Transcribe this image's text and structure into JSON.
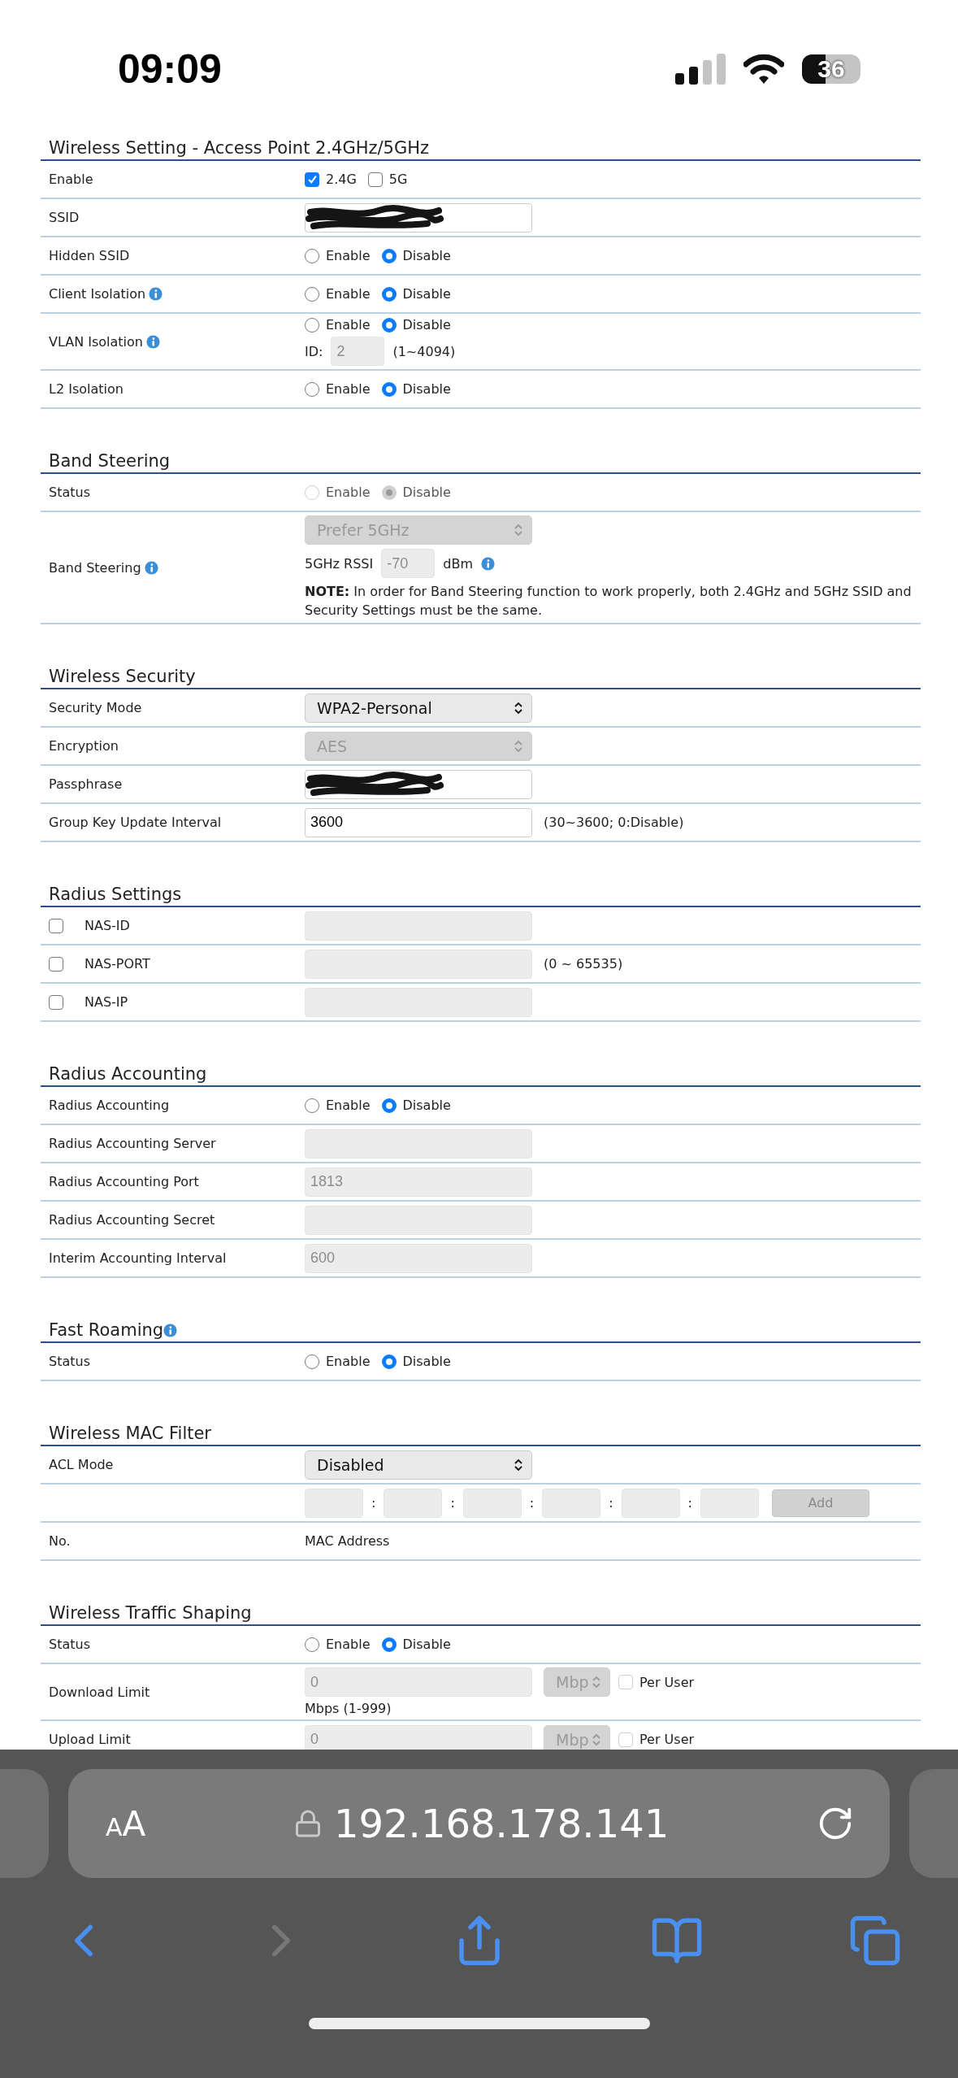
{
  "status_bar": {
    "time": "09:09",
    "battery": "36"
  },
  "sections": [
    {
      "title": "Wireless Setting - Access Point 2.4GHz/5GHz",
      "rows": [
        {
          "label": "Enable",
          "lines": [
            [
              {
                "kind": "checkbox",
                "label": "2.4G",
                "checked": true,
                "disabled": false
              },
              {
                "kind": "checkbox",
                "label": "5G",
                "checked": false,
                "disabled": false
              }
            ]
          ]
        },
        {
          "label": "SSID",
          "lines": [
            [
              {
                "kind": "field",
                "disabled": false,
                "redacted": true
              }
            ]
          ]
        },
        {
          "label": "Hidden SSID",
          "lines": [
            [
              {
                "kind": "radio",
                "label": "Enable",
                "selected": false,
                "disabled": false
              },
              {
                "kind": "radio",
                "label": "Disable",
                "selected": true,
                "disabled": false
              }
            ]
          ]
        },
        {
          "label": "Client Isolation",
          "info": true,
          "lines": [
            [
              {
                "kind": "radio",
                "label": "Enable",
                "selected": false,
                "disabled": false
              },
              {
                "kind": "radio",
                "label": "Disable",
                "selected": true,
                "disabled": false
              }
            ]
          ]
        },
        {
          "label": "VLAN Isolation",
          "info": true,
          "lines": [
            [
              {
                "kind": "radio",
                "label": "Enable",
                "selected": false,
                "disabled": false
              },
              {
                "kind": "radio",
                "label": "Disable",
                "selected": true,
                "disabled": false
              }
            ],
            [
              {
                "kind": "text",
                "text": "ID:"
              },
              {
                "kind": "smallfield",
                "value": "2",
                "disabled": true
              },
              {
                "kind": "text",
                "text": "(1~4094)"
              }
            ]
          ]
        },
        {
          "label": "L2 Isolation",
          "lines": [
            [
              {
                "kind": "radio",
                "label": "Enable",
                "selected": false,
                "disabled": false
              },
              {
                "kind": "radio",
                "label": "Disable",
                "selected": true,
                "disabled": false
              }
            ]
          ]
        }
      ]
    },
    {
      "title": "Band Steering",
      "rows": [
        {
          "label": "Status",
          "lines": [
            [
              {
                "kind": "radio",
                "label": "Enable",
                "selected": false,
                "disabled": true
              },
              {
                "kind": "radio",
                "label": "Disable",
                "selected": true,
                "disabled": true
              }
            ]
          ]
        },
        {
          "label": "Band Steering",
          "info": true,
          "lines": [
            [
              {
                "kind": "select",
                "value": "Prefer 5GHz",
                "disabled": true
              }
            ],
            [
              {
                "kind": "text",
                "text": "5GHz RSSI"
              },
              {
                "kind": "smallfield",
                "value": "-70",
                "disabled": true
              },
              {
                "kind": "text",
                "text": "dBm"
              },
              {
                "kind": "info"
              }
            ],
            [
              {
                "kind": "note",
                "text": "**NOTE:** In order for Band Steering function to work properly, both 2.4GHz and 5GHz SSID and Security Settings must be the same."
              }
            ]
          ]
        }
      ]
    },
    {
      "title": "Wireless Security",
      "rows": [
        {
          "label": "Security Mode",
          "lines": [
            [
              {
                "kind": "select",
                "value": "WPA2-Personal",
                "disabled": false
              }
            ]
          ]
        },
        {
          "label": "Encryption",
          "lines": [
            [
              {
                "kind": "select",
                "value": "AES",
                "disabled": true
              }
            ]
          ]
        },
        {
          "label": "Passphrase",
          "lines": [
            [
              {
                "kind": "field",
                "disabled": false,
                "redacted": true
              }
            ]
          ]
        },
        {
          "label": "Group Key Update Interval",
          "lines": [
            [
              {
                "kind": "field",
                "value": "3600",
                "disabled": false
              },
              {
                "kind": "text",
                "text": "(30~3600; 0:Disable)"
              }
            ]
          ]
        }
      ]
    },
    {
      "title": "Radius Settings",
      "rows": [
        {
          "label": "NAS-ID",
          "check": {
            "checked": false
          },
          "lines": [
            [
              {
                "kind": "field",
                "disabled": true
              }
            ]
          ]
        },
        {
          "label": "NAS-PORT",
          "check": {
            "checked": false
          },
          "lines": [
            [
              {
                "kind": "field",
                "disabled": true
              },
              {
                "kind": "text",
                "text": "(0 ~ 65535)"
              }
            ]
          ]
        },
        {
          "label": "NAS-IP",
          "check": {
            "checked": false
          },
          "lines": [
            [
              {
                "kind": "field",
                "disabled": true
              }
            ]
          ]
        }
      ]
    },
    {
      "title": "Radius Accounting",
      "rows": [
        {
          "label": "Radius Accounting",
          "lines": [
            [
              {
                "kind": "radio",
                "label": "Enable",
                "selected": false,
                "disabled": false
              },
              {
                "kind": "radio",
                "label": "Disable",
                "selected": true,
                "disabled": false
              }
            ]
          ]
        },
        {
          "label": "Radius Accounting Server",
          "lines": [
            [
              {
                "kind": "field",
                "disabled": true
              }
            ]
          ]
        },
        {
          "label": "Radius Accounting Port",
          "lines": [
            [
              {
                "kind": "field",
                "value": "1813",
                "disabled": true
              }
            ]
          ]
        },
        {
          "label": "Radius Accounting Secret",
          "lines": [
            [
              {
                "kind": "field",
                "disabled": true
              }
            ]
          ]
        },
        {
          "label": "Interim Accounting Interval",
          "lines": [
            [
              {
                "kind": "field",
                "value": "600",
                "disabled": true
              }
            ]
          ]
        }
      ]
    },
    {
      "title": "Fast Roaming",
      "info": true,
      "rows": [
        {
          "label": "Status",
          "lines": [
            [
              {
                "kind": "radio",
                "label": "Enable",
                "selected": false,
                "disabled": false
              },
              {
                "kind": "radio",
                "label": "Disable",
                "selected": true,
                "disabled": false
              }
            ]
          ]
        }
      ]
    },
    {
      "title": "Wireless MAC Filter",
      "rows": [
        {
          "label": "ACL Mode",
          "lines": [
            [
              {
                "kind": "select",
                "value": "Disabled",
                "disabled": false
              }
            ]
          ]
        },
        {
          "lines": [
            [
              {
                "kind": "macfield",
                "disabled": true
              },
              {
                "kind": "colon",
                "text": ":"
              },
              {
                "kind": "macfield",
                "disabled": true
              },
              {
                "kind": "colon",
                "text": ":"
              },
              {
                "kind": "macfield",
                "disabled": true
              },
              {
                "kind": "colon",
                "text": ":"
              },
              {
                "kind": "macfield",
                "disabled": true
              },
              {
                "kind": "colon",
                "text": ":"
              },
              {
                "kind": "macfield",
                "disabled": true
              },
              {
                "kind": "colon",
                "text": ":"
              },
              {
                "kind": "macfield",
                "disabled": true
              },
              {
                "kind": "button",
                "label": "Add",
                "disabled": true
              }
            ]
          ]
        },
        {
          "label": "No.",
          "lines": [
            [
              {
                "kind": "text",
                "text": "MAC Address"
              }
            ]
          ]
        }
      ]
    },
    {
      "title": "Wireless Traffic Shaping",
      "rows": [
        {
          "label": "Status",
          "lines": [
            [
              {
                "kind": "radio",
                "label": "Enable",
                "selected": false,
                "disabled": false
              },
              {
                "kind": "radio",
                "label": "Disable",
                "selected": true,
                "disabled": false
              }
            ]
          ]
        },
        {
          "label": "Download Limit",
          "lines": [
            [
              {
                "kind": "field",
                "value": "0",
                "disabled": true
              },
              {
                "kind": "smallselect",
                "value": "Mbp",
                "disabled": true
              },
              {
                "kind": "checkbox",
                "label": "Per User",
                "checked": false,
                "disabled": true
              }
            ],
            [
              {
                "kind": "text",
                "text": "Mbps (1-999)"
              }
            ]
          ]
        },
        {
          "label": "Upload Limit",
          "lines": [
            [
              {
                "kind": "field",
                "value": "0",
                "disabled": true
              },
              {
                "kind": "smallselect",
                "value": "Mbp",
                "disabled": true
              },
              {
                "kind": "checkbox",
                "label": "Per User",
                "checked": false,
                "disabled": true
              }
            ]
          ]
        }
      ]
    }
  ],
  "browser": {
    "text_size": "AA",
    "url": "192.168.178.141",
    "back_enabled": true,
    "forward_enabled": false
  }
}
